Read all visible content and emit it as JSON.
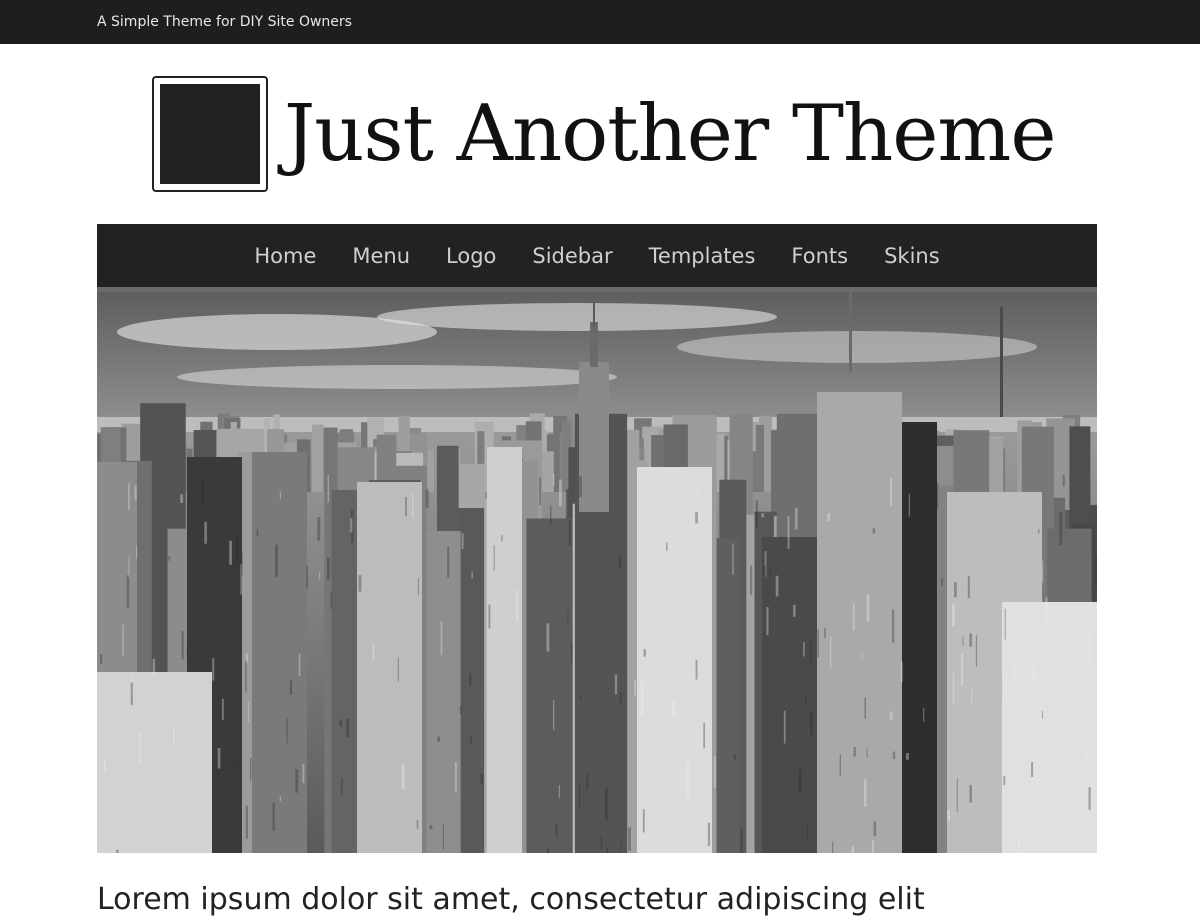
{
  "topbar": {
    "tagline": "A Simple Theme for DIY Site Owners"
  },
  "header": {
    "site_title": "Just Another Theme",
    "logo_icon": "square-logo-icon"
  },
  "nav": {
    "items": [
      {
        "label": "Home"
      },
      {
        "label": "Menu"
      },
      {
        "label": "Logo"
      },
      {
        "label": "Sidebar"
      },
      {
        "label": "Templates"
      },
      {
        "label": "Fonts"
      },
      {
        "label": "Skins"
      }
    ]
  },
  "hero": {
    "image": "grayscale aerial city skyline photo"
  },
  "post": {
    "headline": "Lorem ipsum dolor sit amet, consectetur adipiscing elit"
  },
  "colors": {
    "topbar": "#1e1e1e",
    "nav": "#222222",
    "nav_text": "#cfcfcf",
    "accent_dark": "#222222"
  }
}
